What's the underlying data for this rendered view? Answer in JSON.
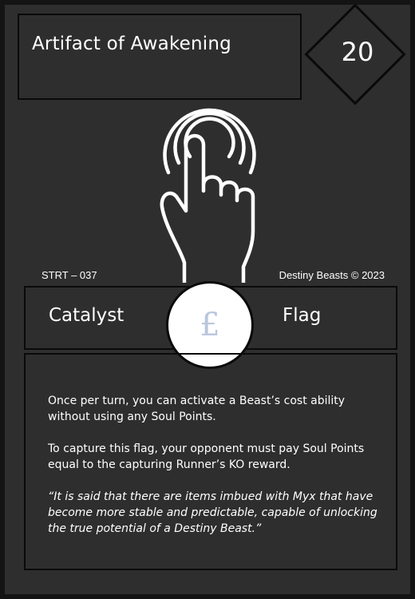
{
  "card": {
    "name": "Artifact of Awakening",
    "cost": "20",
    "set_code": "STRT – 037",
    "copyright": "Destiny Beasts © 2023",
    "type_left": "Catalyst",
    "type_right": "Flag",
    "symbol": "£",
    "symbol_icon": "pound-sign-icon",
    "art_icon": "tap-hand-icon",
    "ability_text": "Once per turn, you can activate a Beast’s cost ability without using any Soul Points.",
    "capture_text": "To capture this flag, your opponent must pay Soul Points equal to the capturing Runner’s KO reward.",
    "flavor_text": "“It is said that there are items imbued with Myx that have become more stable and predictable, capable of unlocking the true potential of a Destiny Beast.”"
  },
  "colors": {
    "card_background": "#2e2e2e",
    "border": "#0a0a0a",
    "text": "#ffffff",
    "symbol": "#b9c7dc"
  }
}
